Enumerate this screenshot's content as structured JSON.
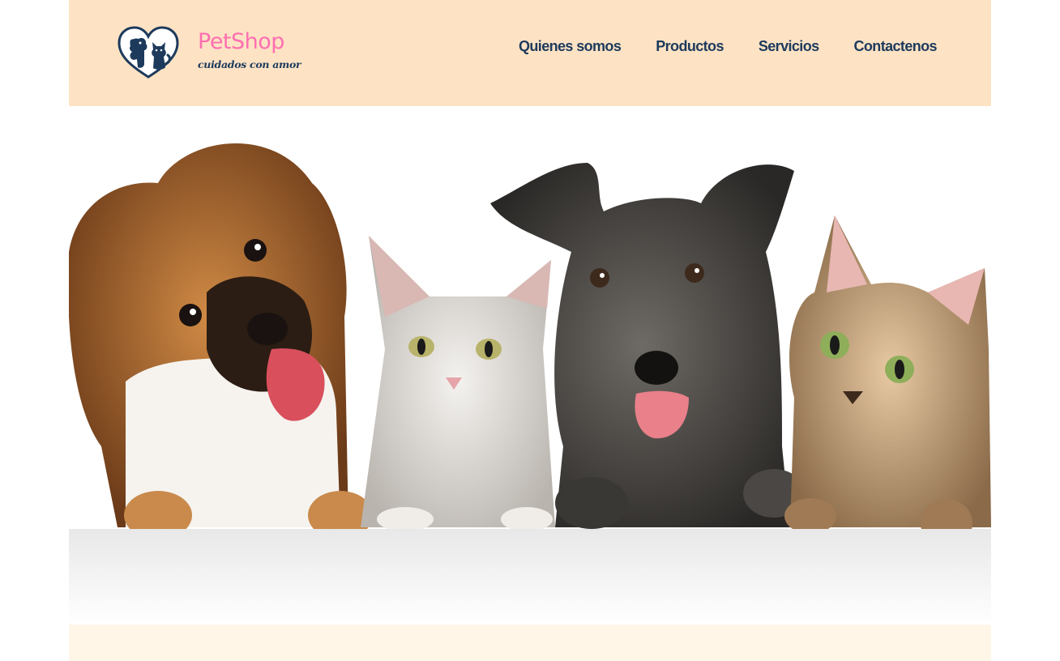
{
  "brand": {
    "name": "PetShop",
    "tagline": "cuidados con amor",
    "logo_icon": "heart-dog-cat-icon"
  },
  "nav": {
    "items": [
      {
        "label": "Quienes somos"
      },
      {
        "label": "Productos"
      },
      {
        "label": "Servicios"
      },
      {
        "label": "Contactenos"
      }
    ]
  },
  "colors": {
    "header_bg": "#fde3c4",
    "brand_pink": "#ff6fb1",
    "navy": "#1d3a5c",
    "footer_bg": "#fff6e8"
  }
}
